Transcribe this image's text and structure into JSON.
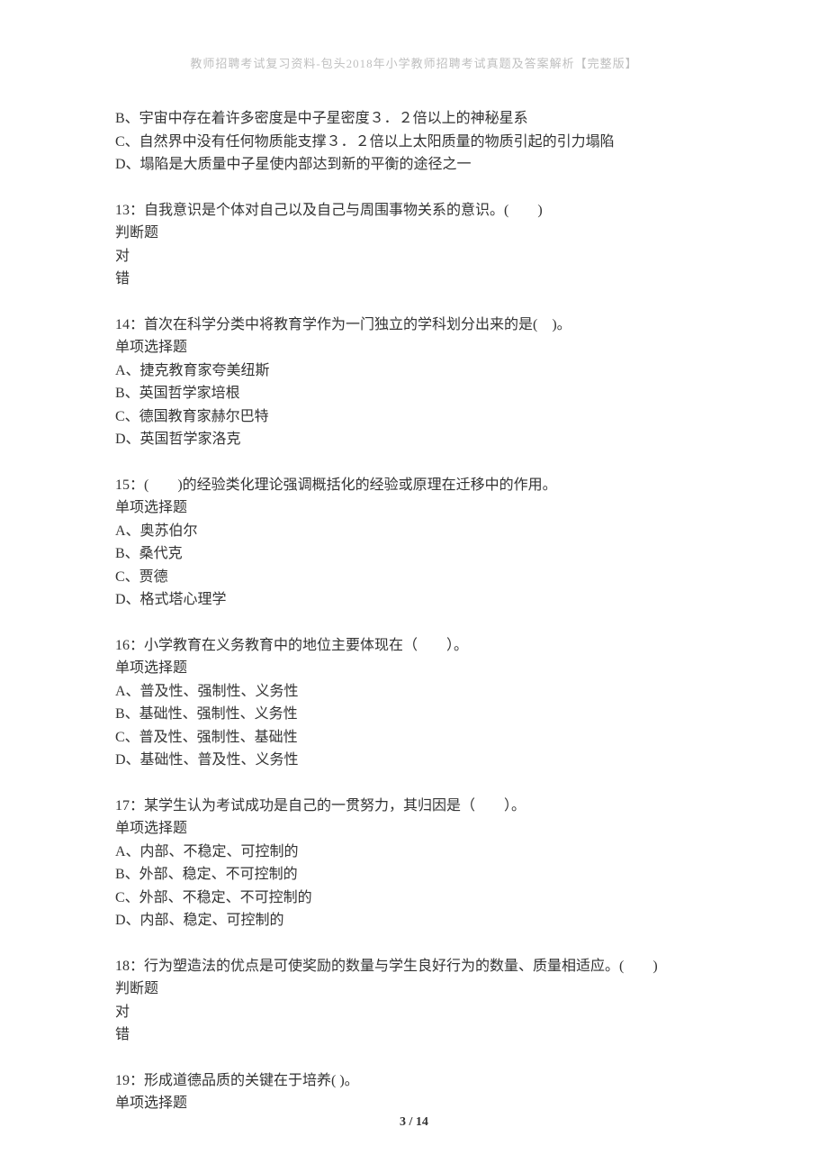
{
  "header": "教师招聘考试复习资料-包头2018年小学教师招聘考试真题及答案解析【完整版】",
  "footer": "3 / 14",
  "q12_remaining_options": [
    "B、宇宙中存在着许多密度是中子星密度３．２倍以上的神秘星系",
    "C、自然界中没有任何物质能支撑３．２倍以上太阳质量的物质引起的引力塌陷",
    "D、塌陷是大质量中子星使内部达到新的平衡的途径之一"
  ],
  "questions": [
    {
      "num": "13",
      "stem": "13：自我意识是个体对自己以及自己与周围事物关系的意识。(　　)",
      "type": "判断题",
      "options": [
        "对",
        "错"
      ]
    },
    {
      "num": "14",
      "stem": "14：首次在科学分类中将教育学作为一门独立的学科划分出来的是(　)。",
      "type": "单项选择题",
      "options": [
        "A、捷克教育家夸美纽斯",
        "B、英国哲学家培根",
        "C、德国教育家赫尔巴特",
        "D、英国哲学家洛克"
      ]
    },
    {
      "num": "15",
      "stem": "15：(　　)的经验类化理论强调概括化的经验或原理在迁移中的作用。",
      "type": "单项选择题",
      "options": [
        "A、奥苏伯尔",
        "B、桑代克",
        "C、贾德",
        "D、格式塔心理学"
      ]
    },
    {
      "num": "16",
      "stem": "16：小学教育在义务教育中的地位主要体现在（　　）。",
      "type": "单项选择题",
      "options": [
        "A、普及性、强制性、义务性",
        "B、基础性、强制性、义务性",
        "C、普及性、强制性、基础性",
        "D、基础性、普及性、义务性"
      ]
    },
    {
      "num": "17",
      "stem": "17：某学生认为考试成功是自己的一贯努力，其归因是（　　）。",
      "type": "单项选择题",
      "options": [
        "A、内部、不稳定、可控制的",
        "B、外部、稳定、不可控制的",
        "C、外部、不稳定、不可控制的",
        "D、内部、稳定、可控制的"
      ]
    },
    {
      "num": "18",
      "stem": "18：行为塑造法的优点是可使奖励的数量与学生良好行为的数量、质量相适应。(　　)",
      "type": "判断题",
      "options": [
        "对",
        "错"
      ]
    },
    {
      "num": "19",
      "stem": "19：形成道德品质的关键在于培养( )。",
      "type": "单项选择题",
      "options": []
    }
  ]
}
